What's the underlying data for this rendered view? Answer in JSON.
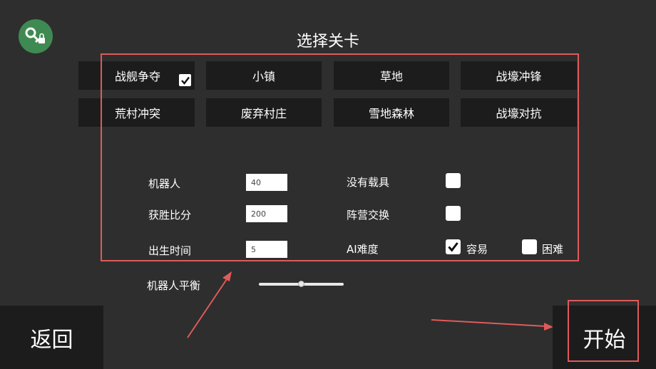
{
  "header": {
    "title": "选择关卡"
  },
  "maps": [
    {
      "label": "战舰争夺",
      "selected": true
    },
    {
      "label": "小镇",
      "selected": false
    },
    {
      "label": "草地",
      "selected": false
    },
    {
      "label": "战壕冲锋",
      "selected": false
    },
    {
      "label": "荒村冲突",
      "selected": false
    },
    {
      "label": "废弃村庄",
      "selected": false
    },
    {
      "label": "雪地森林",
      "selected": false
    },
    {
      "label": "战壕对抗",
      "selected": false
    }
  ],
  "settings": {
    "bots": {
      "label": "机器人",
      "value": "40"
    },
    "win_ratio": {
      "label": "获胜比分",
      "value": "200"
    },
    "spawn_time": {
      "label": "出生时间",
      "value": "5"
    },
    "no_vehicles": {
      "label": "没有载具",
      "checked": false
    },
    "team_swap": {
      "label": "阵营交换",
      "checked": false
    },
    "ai_difficulty": {
      "label": "AI难度",
      "easy": {
        "label": "容易",
        "checked": true
      },
      "hard": {
        "label": "困难",
        "checked": false
      }
    },
    "bot_balance": {
      "label": "机器人平衡",
      "value": 0.5
    }
  },
  "footer": {
    "back_label": "返回",
    "start_label": "开始"
  },
  "colors": {
    "background": "#2e2e2e",
    "button": "#1c1c1c",
    "annotation": "#e05a5a",
    "logo": "#3f8a52"
  }
}
